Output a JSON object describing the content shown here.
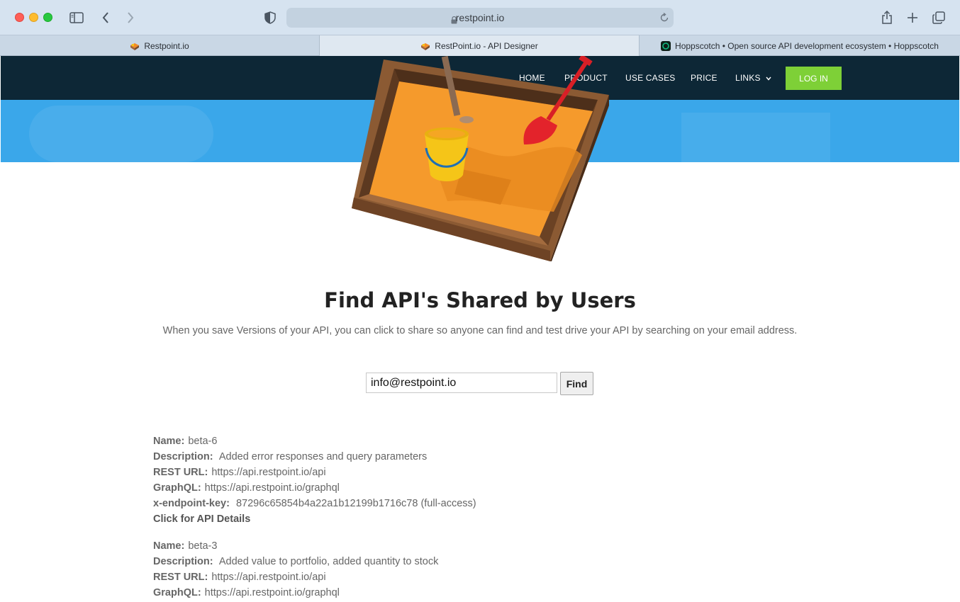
{
  "browser": {
    "url": "restpoint.io",
    "tabs": [
      {
        "label": "Restpoint.io",
        "active": false
      },
      {
        "label": "RestPoint.io - API Designer",
        "active": true
      },
      {
        "label": "Hoppscotch • Open source API development ecosystem • Hoppscotch",
        "active": false
      }
    ]
  },
  "nav": {
    "home": "HOME",
    "product": "PRODUCT",
    "use_cases": "USE CASES",
    "price": "PRICE",
    "links": "LINKS",
    "login": "LOG IN"
  },
  "colors": {
    "hero_blue": "#3aa7ea",
    "nav_dark": "#0a1c26",
    "login_green": "#7ed037"
  },
  "main": {
    "title": "Find API's Shared by Users",
    "description": "When you save Versions of your API, you can click to share so anyone can find and test drive your API by searching on your email address.",
    "search": {
      "value": "info@restpoint.io",
      "button": "Find"
    }
  },
  "labels": {
    "name": "Name:",
    "description": "Description:",
    "rest_url": "REST URL:",
    "graphql": "GraphQL:",
    "key": "x-endpoint-key:",
    "details": "Click for API Details"
  },
  "apis": [
    {
      "name": "beta-6",
      "description": "Added error responses and query parameters",
      "rest_url": "https://api.restpoint.io/api",
      "graphql": "https://api.restpoint.io/graphql",
      "key": "87296c65854b4a22a1b12199b1716c78 (full-access)"
    },
    {
      "name": "beta-3",
      "description": "Added value to portfolio, added quantity to stock",
      "rest_url": "https://api.restpoint.io/api",
      "graphql": "https://api.restpoint.io/graphql"
    }
  ]
}
